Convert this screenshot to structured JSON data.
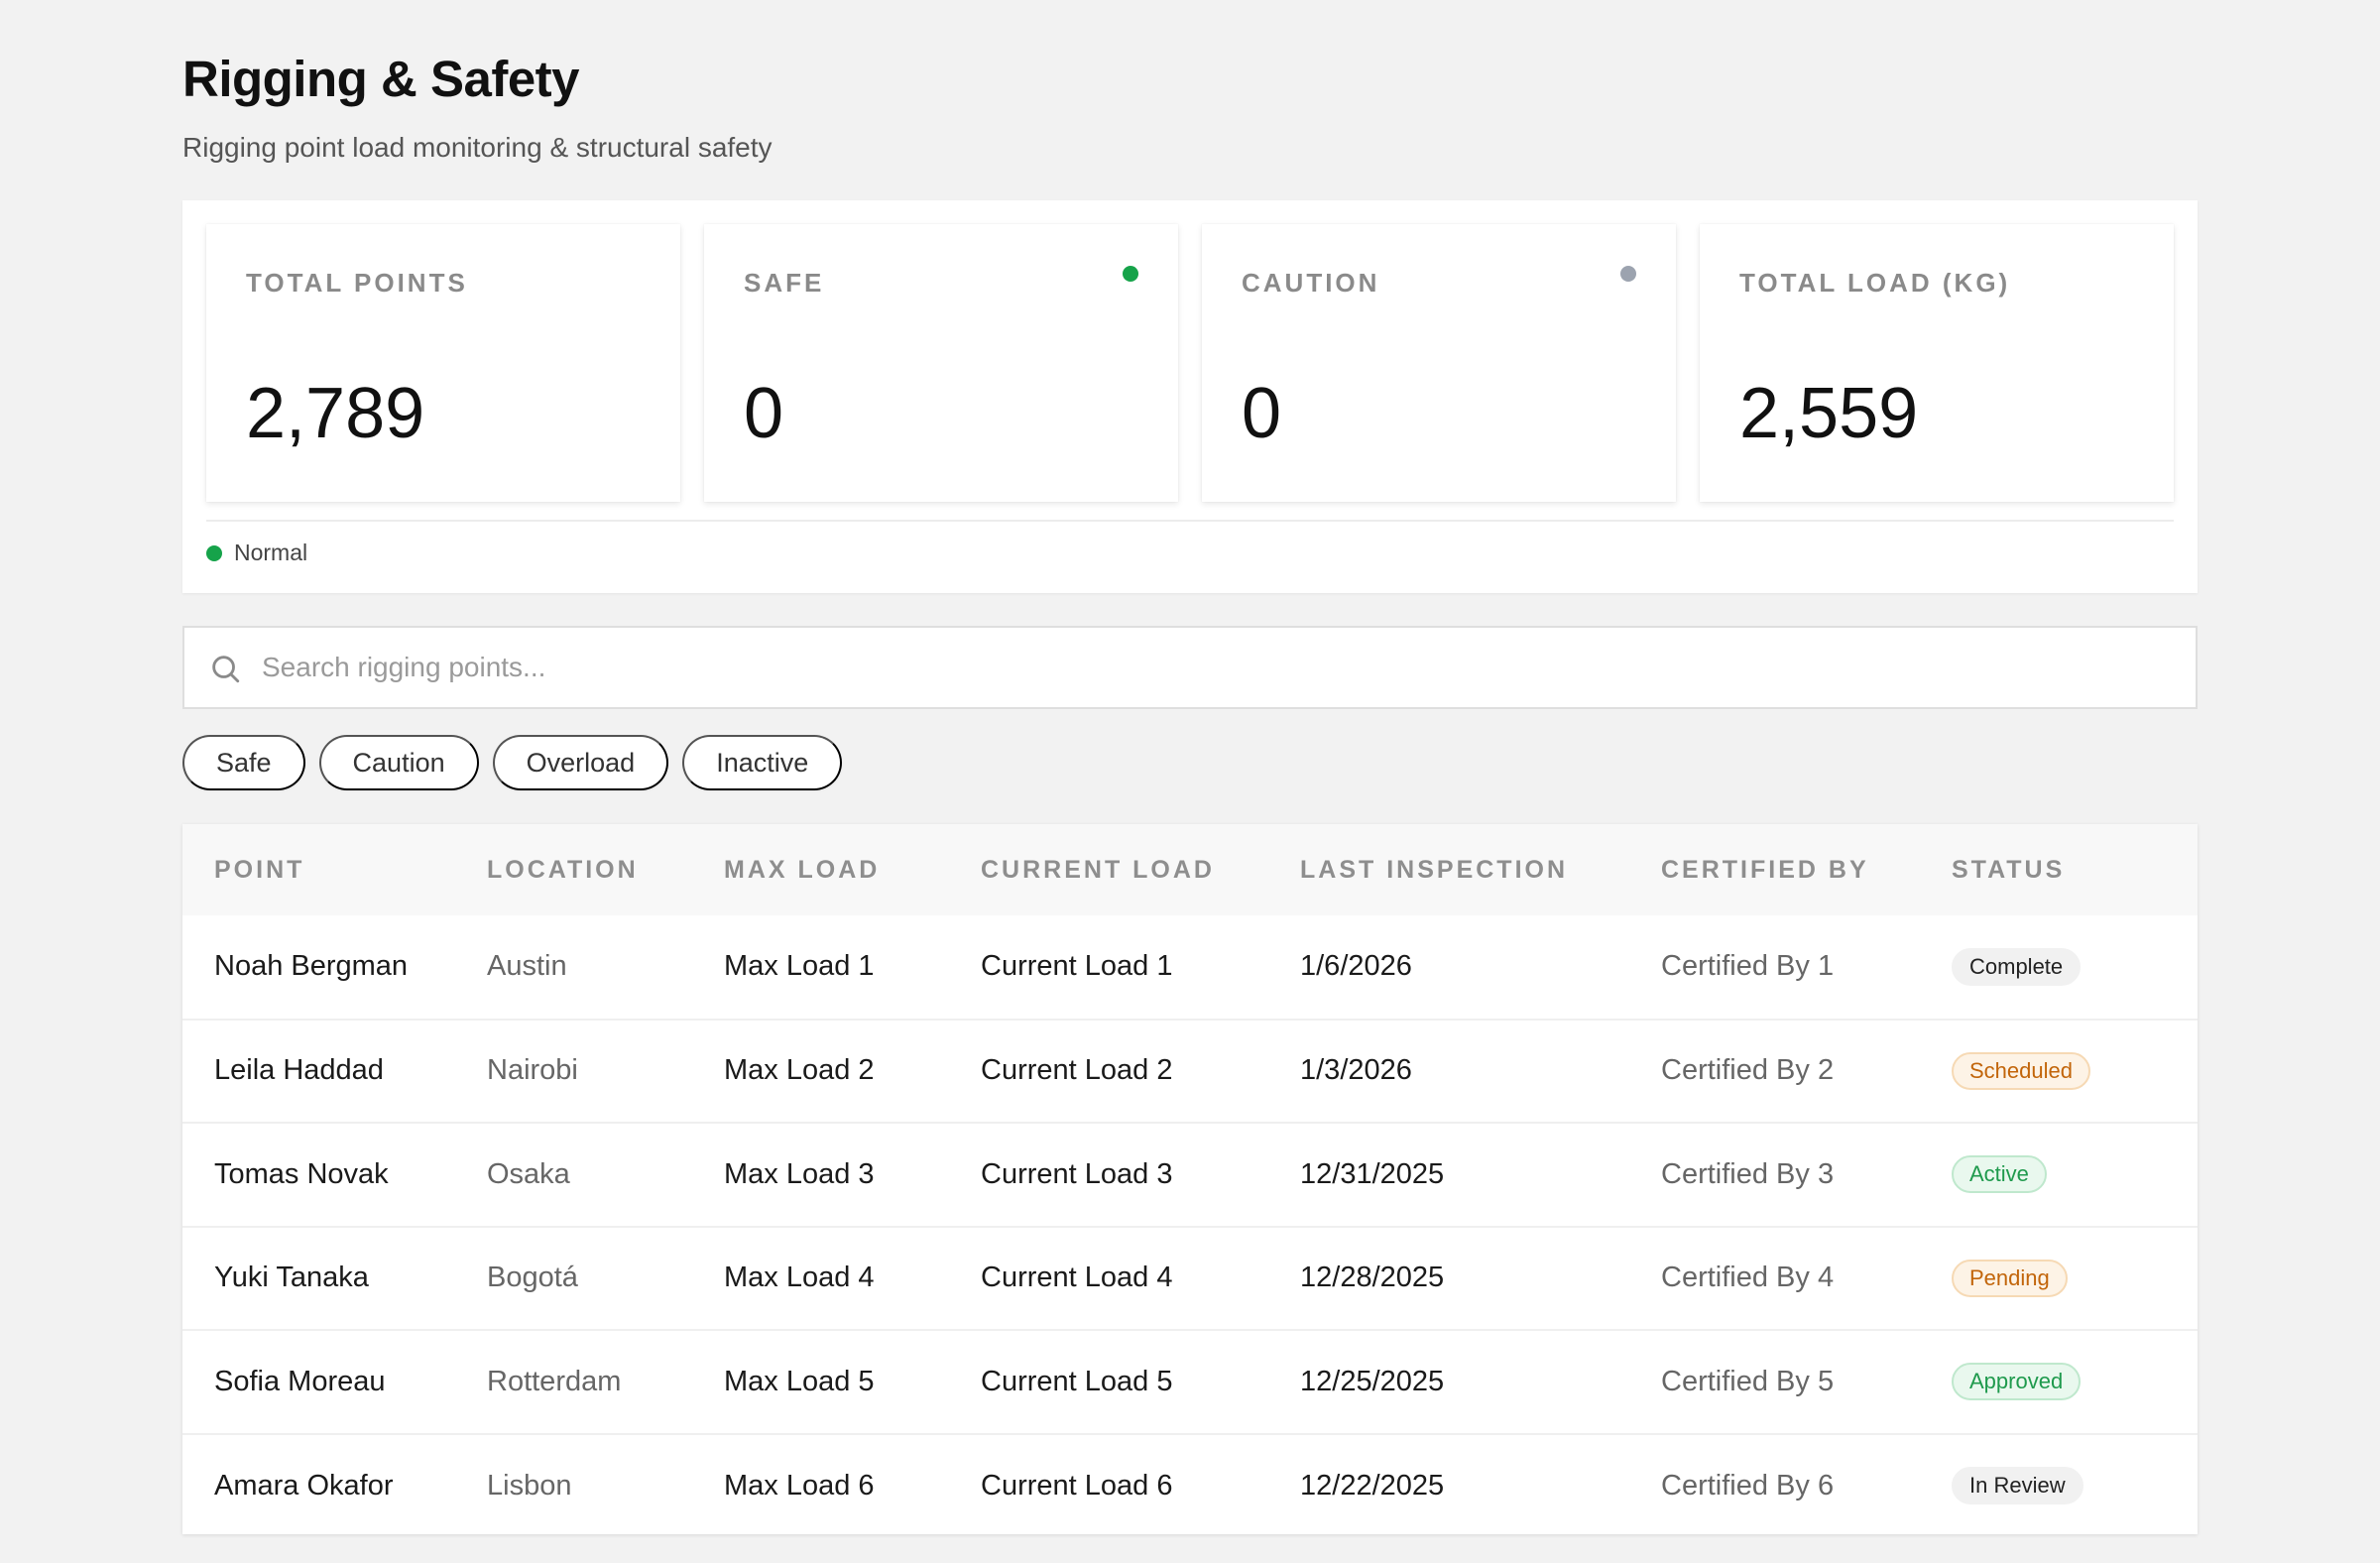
{
  "page": {
    "title": "Rigging & Safety",
    "subtitle": "Rigging point load monitoring & structural safety"
  },
  "stats": [
    {
      "label": "TOTAL POINTS",
      "value": "2,789",
      "dot": null
    },
    {
      "label": "SAFE",
      "value": "0",
      "dot": "#16a34a"
    },
    {
      "label": "CAUTION",
      "value": "0",
      "dot": "#9ca3af"
    },
    {
      "label": "TOTAL LOAD (KG)",
      "value": "2,559",
      "dot": null
    }
  ],
  "legend": {
    "label": "Normal",
    "color": "#16a34a"
  },
  "search": {
    "placeholder": "Search rigging points...",
    "value": ""
  },
  "filters": [
    "Safe",
    "Caution",
    "Overload",
    "Inactive"
  ],
  "table": {
    "columns": [
      "POINT",
      "LOCATION",
      "MAX LOAD",
      "CURRENT LOAD",
      "LAST INSPECTION",
      "CERTIFIED BY",
      "STATUS"
    ],
    "rows": [
      {
        "point": "Noah Bergman",
        "location": "Austin",
        "max_load": "Max Load 1",
        "current_load": "Current Load 1",
        "last_inspection": "1/6/2026",
        "certified_by": "Certified By 1",
        "status": "Complete",
        "status_style": "neutral"
      },
      {
        "point": "Leila Haddad",
        "location": "Nairobi",
        "max_load": "Max Load 2",
        "current_load": "Current Load 2",
        "last_inspection": "1/3/2026",
        "certified_by": "Certified By 2",
        "status": "Scheduled",
        "status_style": "orange"
      },
      {
        "point": "Tomas Novak",
        "location": "Osaka",
        "max_load": "Max Load 3",
        "current_load": "Current Load 3",
        "last_inspection": "12/31/2025",
        "certified_by": "Certified By 3",
        "status": "Active",
        "status_style": "green"
      },
      {
        "point": "Yuki Tanaka",
        "location": "Bogotá",
        "max_load": "Max Load 4",
        "current_load": "Current Load 4",
        "last_inspection": "12/28/2025",
        "certified_by": "Certified By 4",
        "status": "Pending",
        "status_style": "orange"
      },
      {
        "point": "Sofia Moreau",
        "location": "Rotterdam",
        "max_load": "Max Load 5",
        "current_load": "Current Load 5",
        "last_inspection": "12/25/2025",
        "certified_by": "Certified By 5",
        "status": "Approved",
        "status_style": "green"
      },
      {
        "point": "Amara Okafor",
        "location": "Lisbon",
        "max_load": "Max Load 6",
        "current_load": "Current Load 6",
        "last_inspection": "12/22/2025",
        "certified_by": "Certified By 6",
        "status": "In Review",
        "status_style": "neutral"
      }
    ]
  }
}
